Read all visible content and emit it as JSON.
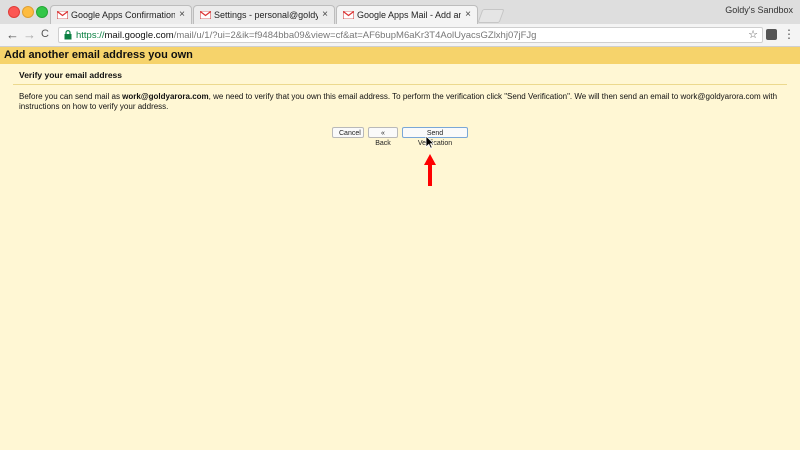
{
  "browser": {
    "profile_name": "Goldy's Sandbox",
    "tabs": [
      {
        "title": "Google Apps Confirmation - Sc",
        "close": "×",
        "active": false
      },
      {
        "title": "Settings - personal@goldyaror",
        "close": "×",
        "active": false
      },
      {
        "title": "Google Apps Mail - Add anothe",
        "close": "×",
        "active": true
      }
    ],
    "nav": {
      "back": "←",
      "forward": "→",
      "reload": "C"
    },
    "url": {
      "scheme": "https://",
      "host": "mail.google.com",
      "path": "/mail/u/1/?ui=2&ik=f9484bba09&view=cf&at=AF6bupM6aKr3T4AolUyacsGZlxhj07jFJg"
    },
    "bookmark_star": "☆",
    "menu": "⋮"
  },
  "page": {
    "header_title": "Add another email address you own",
    "section_title": "Verify your email address",
    "body": {
      "part1": "Before you can send mail as ",
      "email": "work@goldyarora.com",
      "part2": ", we need to verify that you own this email address. To perform the verification click \"Send Verification\". We will then send an email to work@goldyarora.com with instructions on how to verify your address."
    },
    "buttons": {
      "cancel": "Cancel",
      "back": "« Back",
      "send": "Send Verification"
    }
  },
  "colors": {
    "header_bg": "#f6d36b",
    "page_bg": "#fff7d4",
    "annotation_arrow": "#ff0000"
  }
}
